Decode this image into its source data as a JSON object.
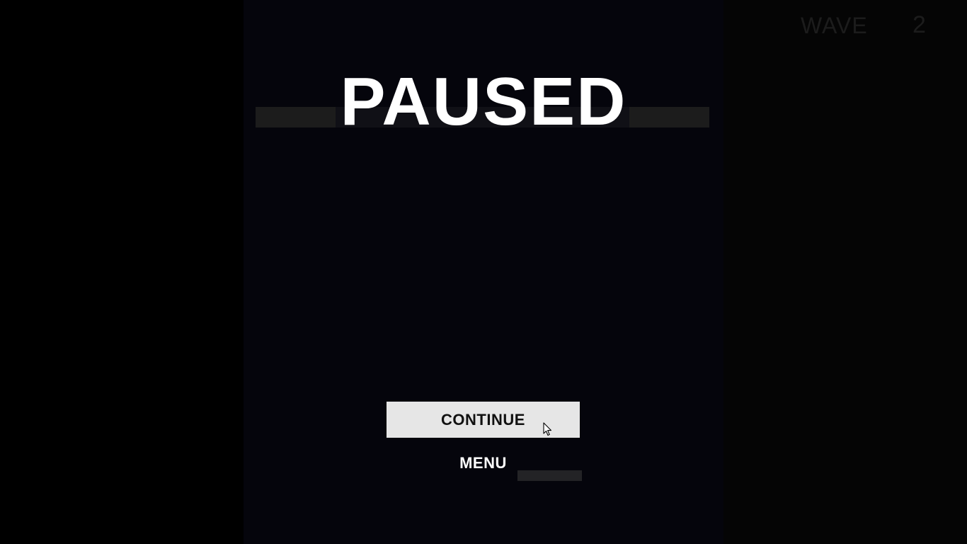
{
  "hud": {
    "wave_label": "WAVE",
    "wave_value": "2"
  },
  "pause_menu": {
    "title": "PAUSED",
    "continue_label": "CONTINUE",
    "menu_label": "MENU"
  },
  "colors": {
    "title": "#ffffff",
    "continue_bg": "#e6e6e6",
    "continue_text": "#111111",
    "hud_text": "#1c1c1c",
    "playfield_bg": "#05050c"
  },
  "icons": {
    "cursor": "mouse-pointer-icon"
  }
}
